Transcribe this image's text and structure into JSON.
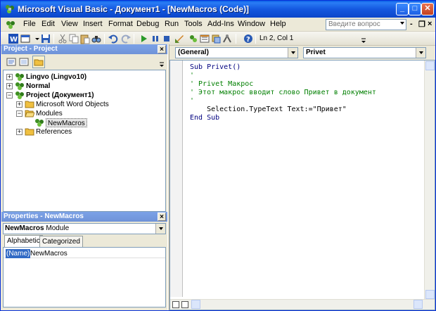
{
  "window": {
    "title": "Microsoft Visual Basic - Документ1 - [NewMacros (Code)]",
    "minimize": "_",
    "maximize": "□",
    "close": "✕"
  },
  "menubar": {
    "items": [
      {
        "label": "File"
      },
      {
        "label": "Edit"
      },
      {
        "label": "View"
      },
      {
        "label": "Insert"
      },
      {
        "label": "Format"
      },
      {
        "label": "Debug"
      },
      {
        "label": "Run"
      },
      {
        "label": "Tools"
      },
      {
        "label": "Add-Ins"
      },
      {
        "label": "Window"
      },
      {
        "label": "Help"
      }
    ],
    "ask_placeholder": "Введите вопрос",
    "mdi_min": "-",
    "mdi_restore": "❐",
    "mdi_close": "×"
  },
  "toolbar": {
    "status": "Ln 2, Col 1"
  },
  "project_pane": {
    "title": "Project - Project",
    "close": "×",
    "tree": [
      {
        "label": "Lingvo (Lingvo10)"
      },
      {
        "label": "Normal"
      },
      {
        "label": "Project (Документ1)"
      },
      {
        "label": "Microsoft Word Objects"
      },
      {
        "label": "Modules"
      },
      {
        "label": "NewMacros"
      },
      {
        "label": "References"
      }
    ]
  },
  "properties_pane": {
    "title": "Properties - NewMacros",
    "close": "×",
    "object_name": "NewMacros",
    "object_type": "Module",
    "tabs": [
      {
        "label": "Alphabetic"
      },
      {
        "label": "Categorized"
      }
    ],
    "rows": [
      {
        "name": "(Name)",
        "value": "NewMacros"
      }
    ]
  },
  "code_window": {
    "object_combo": "(General)",
    "proc_combo": "Privet",
    "lines": [
      "Sub Privet()",
      "'",
      "' Privet Макрос",
      "' Этот макрос вводит слово Привет в документ",
      "'",
      "    Selection.TypeText Text:=\"Привет\"",
      "End Sub"
    ]
  },
  "colors": {
    "titlebar": "#0b46c9",
    "keyword": "#00007f",
    "comment": "#007f00"
  }
}
